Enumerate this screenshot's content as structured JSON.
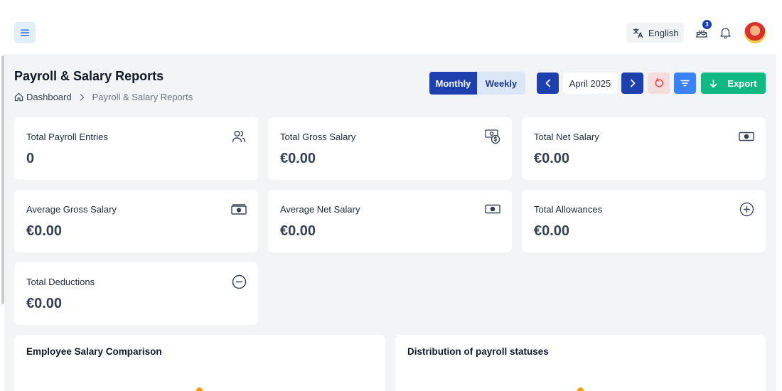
{
  "header": {
    "language_label": "English",
    "notification_count": "3"
  },
  "page": {
    "title": "Payroll & Salary Reports",
    "breadcrumb": {
      "home": "Dashboard",
      "current": "Payroll & Salary Reports"
    }
  },
  "toolbar": {
    "period_options": [
      "Monthly",
      "Weekly"
    ],
    "selected_period": "Monthly",
    "current_date": "April 2025",
    "export_label": "Export"
  },
  "cards": [
    {
      "label": "Total Payroll Entries",
      "value": "0",
      "icon": "users-icon"
    },
    {
      "label": "Total Gross Salary",
      "value": "€0.00",
      "icon": "money-coin-icon"
    },
    {
      "label": "Total Net Salary",
      "value": "€0.00",
      "icon": "banknote-icon"
    },
    {
      "label": "Average Gross Salary",
      "value": "€0.00",
      "icon": "money-stack-icon"
    },
    {
      "label": "Average Net Salary",
      "value": "€0.00",
      "icon": "banknote-icon"
    },
    {
      "label": "Total Allowances",
      "value": "€0.00",
      "icon": "plus-circle-icon"
    },
    {
      "label": "Total Deductions",
      "value": "€0.00",
      "icon": "minus-circle-icon"
    }
  ],
  "panels": [
    {
      "title": "Employee Salary Comparison"
    },
    {
      "title": "Distribution of payroll statuses"
    }
  ],
  "colors": {
    "primary": "#1e40af",
    "export": "#10b981",
    "filter": "#3b82f6",
    "reset": "#ef4444",
    "chart_accent": "#f59e0b"
  }
}
